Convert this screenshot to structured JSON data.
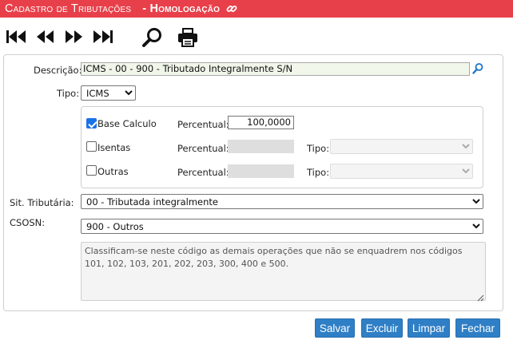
{
  "header": {
    "title": "Cadastro de Tributações",
    "subtitle": "- Homologação",
    "link_icon": "link-icon",
    "accent": "#e8404a"
  },
  "toolbar": {
    "first_icon": "first-record-icon",
    "prev_icon": "previous-record-icon",
    "next_icon": "next-record-icon",
    "last_icon": "last-record-icon",
    "search_icon": "search-icon",
    "print_icon": "printer-icon"
  },
  "form": {
    "descricao_label": "Descrição:",
    "descricao_value": "ICMS - 00 - 900 - Tributado Integralmente S/N",
    "tipo_label": "Tipo:",
    "tipo_value": "ICMS",
    "base_calculo": {
      "label": "Base Calculo",
      "checked": true,
      "percentual_label": "Percentual:",
      "percentual_value": "100,0000"
    },
    "isentas": {
      "label": "Isentas",
      "checked": false,
      "percentual_label": "Percentual:",
      "tipo_label": "Tipo:"
    },
    "outras": {
      "label": "Outras",
      "checked": false,
      "percentual_label": "Percentual:",
      "tipo_label": "Tipo:"
    },
    "sit_tributaria_label": "Sit. Tributária:",
    "sit_tributaria_value": "00 - Tributada integralmente",
    "csosn_label": "CSOSN:",
    "csosn_value": "900 - Outros",
    "csosn_description": "Classificam-se neste código as demais operações que não se enquadrem nos códigos 101, 102, 103, 201, 202, 203, 300, 400 e 500."
  },
  "buttons": {
    "salvar": "Salvar",
    "excluir": "Excluir",
    "limpar": "Limpar",
    "fechar": "Fechar",
    "color": "#2f7fc6"
  }
}
